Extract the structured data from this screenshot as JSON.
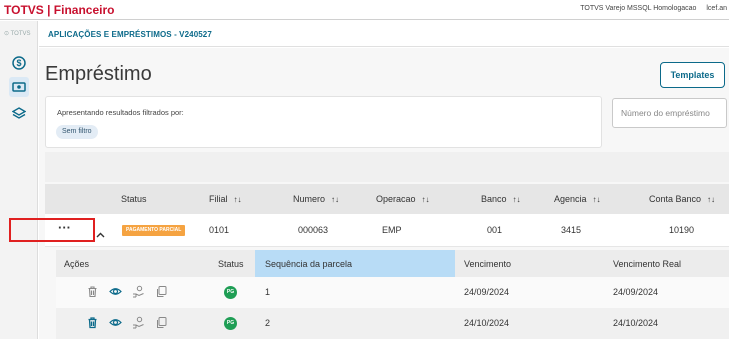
{
  "topbar": {
    "app_title": "TOTVS | Financeiro",
    "environment": "TOTVS Varejo MSSQL Homologacao",
    "user": "lcef.an"
  },
  "sidebar": {
    "logo_text": "TOTVS",
    "items": [
      {
        "icon": "dollar-circle-icon"
      },
      {
        "icon": "money-bill-icon",
        "active": true
      },
      {
        "icon": "layers-icon"
      }
    ]
  },
  "breadcrumb": "APLICAÇÕES E EMPRÉSTIMOS - V240527",
  "page": {
    "title": "Empréstimo",
    "templates_button": "Templates"
  },
  "filter": {
    "label": "Apresentando resultados filtrados por:",
    "chip": "Sem filtro"
  },
  "search": {
    "placeholder": "Número do empréstimo",
    "value": ""
  },
  "table": {
    "columns": [
      "Status",
      "Filial",
      "Numero",
      "Operacao",
      "Banco",
      "Agencia",
      "Conta Banco"
    ],
    "rows": [
      {
        "status": "PAGAMENTO PARCIAL",
        "filial": "0101",
        "numero": "000063",
        "operacao": "EMP",
        "banco": "001",
        "agencia": "3415",
        "conta_banco": "10190"
      }
    ]
  },
  "subtable": {
    "columns": [
      "Ações",
      "Status",
      "Sequência da parcela",
      "Vencimento",
      "Vencimento Real"
    ],
    "rows": [
      {
        "status": "PG",
        "sequencia": "1",
        "vencimento": "24/09/2024",
        "vencimento_real": "24/09/2024"
      },
      {
        "status": "PG",
        "sequencia": "2",
        "vencimento": "24/10/2024",
        "vencimento_real": "24/10/2024"
      }
    ]
  },
  "colors": {
    "brand_red": "#c8102e",
    "primary": "#0c6a8a",
    "badge_partial": "#f5a341",
    "badge_paid": "#1f9e55",
    "highlight": "#e02020",
    "active_column": "#b8dcf6"
  }
}
